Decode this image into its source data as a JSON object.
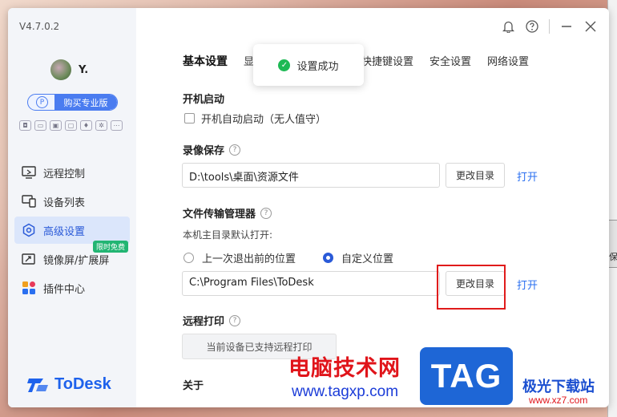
{
  "app": {
    "version": "V4.7.0.2",
    "username": "Y.",
    "pro_button": "购买专业版",
    "logo_text": "ToDesk"
  },
  "sidebar": {
    "items": [
      {
        "label": "远程控制",
        "icon": "remote-control-icon"
      },
      {
        "label": "设备列表",
        "icon": "device-list-icon"
      },
      {
        "label": "高级设置",
        "icon": "advanced-settings-icon",
        "active": true
      },
      {
        "label": "镜像屏/扩展屏",
        "icon": "mirror-screen-icon",
        "badge": "限时免费"
      },
      {
        "label": "插件中心",
        "icon": "plugin-center-icon"
      }
    ]
  },
  "tabs": [
    "基本设置",
    "显",
    "快捷键设置",
    "安全设置",
    "网络设置"
  ],
  "toast": {
    "text": "设置成功"
  },
  "settings": {
    "startup": {
      "title": "开机启动",
      "checkbox": "开机自动启动（无人值守）"
    },
    "recording": {
      "title": "录像保存",
      "path": "D:\\tools\\桌面\\资源文件",
      "change_btn": "更改目录",
      "open_link": "打开"
    },
    "file_transfer": {
      "title": "文件传输管理器",
      "subtext": "本机主目录默认打开:",
      "option_last": "上一次退出前的位置",
      "option_custom": "自定义位置",
      "path": "C:\\Program Files\\ToDesk",
      "change_btn": "更改目录",
      "open_link": "打开"
    },
    "remote_print": {
      "title": "远程打印",
      "status": "当前设备已支持远程打印"
    },
    "about": {
      "title": "关于"
    }
  },
  "watermark": {
    "cn": "电脑技术网",
    "url": "www.tagxp.com",
    "tag": "TAG",
    "site_cn": "极光下载站",
    "site_url": "www.xz7.com"
  },
  "background": {
    "side_char": "保"
  }
}
